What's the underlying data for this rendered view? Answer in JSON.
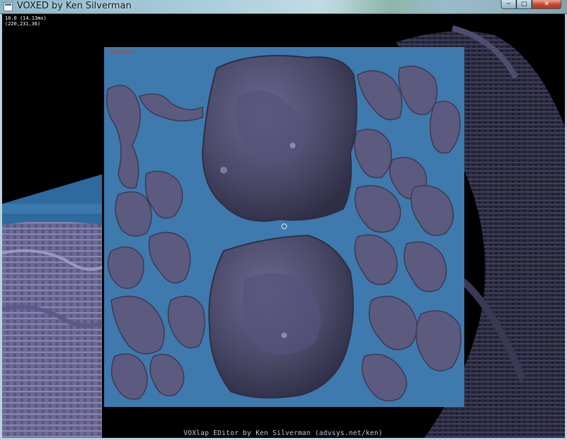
{
  "window": {
    "title": "VOXED by Ken Silverman",
    "buttons": {
      "minimize": "─",
      "maximize": "□",
      "close": "✕"
    }
  },
  "hud": {
    "fps": "10.0 (14.13ms)",
    "position": "(220,231,36)"
  },
  "texture_panel": {
    "label": "Tapestex"
  },
  "footer": {
    "credit": "VOXlap EDitor by Ken Silverman (advsys.net/ken)"
  },
  "colors": {
    "sky": "#000000",
    "water": "#3e7aae",
    "voxel_rock": "#5c5a7e",
    "voxel_rock_dark": "#3b3a55",
    "title_text": "#0e1b22",
    "label_red": "#c2482c"
  },
  "icons": {
    "app_icon": "window-app-icon",
    "cursor": "crosshair-ring-icon"
  }
}
